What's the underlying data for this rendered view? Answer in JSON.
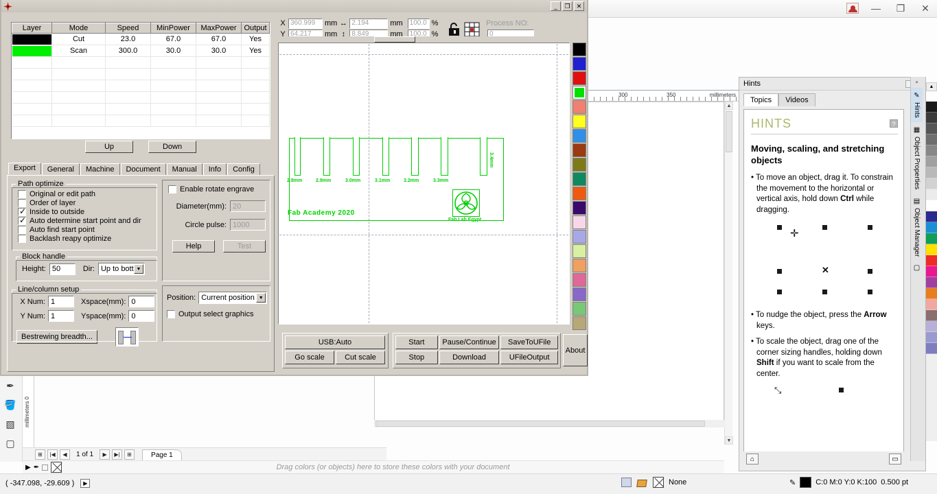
{
  "corel": {
    "window_controls": {
      "minimize": "—",
      "restore": "❐",
      "close": "✕"
    },
    "ruler": {
      "ticks": [
        "300",
        "350"
      ],
      "units": "millimeters",
      "vertical_label": "millimeters 0"
    },
    "page_nav": {
      "count": "1 of 1",
      "page_tab": "Page 1",
      "first": "|◀",
      "prev": "◀",
      "next": "▶",
      "last": "▶|",
      "add_before": "⊞",
      "add_after": "⊞"
    },
    "drag_hint": "Drag colors (or objects) here to store these colors with your document",
    "status": {
      "coords": "( -347.098, -29.609 )",
      "fill": "None",
      "outline": "C:0 M:0 Y:0 K:100",
      "outline_width": "0.500 pt"
    },
    "palette_colors": [
      "#1a1a1a",
      "#3b3b3b",
      "#555555",
      "#6e6e6e",
      "#878787",
      "#a0a0a0",
      "#b9b9b9",
      "#d2d2d2",
      "#ebebeb",
      "#ffffff",
      "#2b2b8f",
      "#1a8fd6",
      "#0f9d58",
      "#ffe000",
      "#ef2a2a",
      "#e8188f",
      "#a13fa0",
      "#e87d1e",
      "#f0a8a0",
      "#8a6f6f",
      "#b8b0d8",
      "#9a9ad0",
      "#7d7dc0"
    ]
  },
  "docker_tabs": [
    {
      "label": "Hints",
      "selected": true
    },
    {
      "label": "Object Properties",
      "selected": false
    },
    {
      "label": "Object Manager",
      "selected": false
    }
  ],
  "hints": {
    "title": "Hints",
    "tabs": [
      {
        "label": "Topics",
        "active": true
      },
      {
        "label": "Videos",
        "active": false
      }
    ],
    "heading": "HINTS",
    "help_badge": "?",
    "subheading": "Moving, scaling, and stretching objects",
    "bullets": [
      {
        "pre": "• To move an object, drag it. To constrain the movement to the horizontal or vertical axis, hold down ",
        "bold": "Ctrl",
        "post": " while dragging."
      },
      {
        "pre": "• To nudge the object, press the ",
        "bold": "Arrow",
        "post": " keys."
      },
      {
        "pre": "• To scale the object, drag one of the corner sizing handles, holding down ",
        "bold": "Shift",
        "post": " if you want to scale from the center."
      }
    ],
    "move_cursor": "✛",
    "center_marker": "✕",
    "scale_cursor": "⤡"
  },
  "laser": {
    "title": "",
    "window_controls": {
      "minimize": "_",
      "restore": "❐",
      "close": "✕"
    },
    "layer_table": {
      "headers": [
        "Layer",
        "Mode",
        "Speed",
        "MinPower",
        "MaxPower",
        "Output"
      ],
      "rows": [
        {
          "color": "#000000",
          "mode": "Cut",
          "speed": "23.0",
          "min_power": "67.0",
          "max_power": "67.0",
          "output": "Yes"
        },
        {
          "color": "#00ee00",
          "mode": "Scan",
          "speed": "300.0",
          "min_power": "30.0",
          "max_power": "30.0",
          "output": "Yes"
        }
      ]
    },
    "order_buttons": {
      "up": "Up",
      "down": "Down"
    },
    "tabs": [
      {
        "label": "Export",
        "active": true
      },
      {
        "label": "General",
        "active": false
      },
      {
        "label": "Machine",
        "active": false
      },
      {
        "label": "Document",
        "active": false
      },
      {
        "label": "Manual",
        "active": false
      },
      {
        "label": "Info",
        "active": false
      },
      {
        "label": "Config",
        "active": false
      }
    ],
    "path_optimize": {
      "legend": "Path optimize",
      "items": [
        {
          "label": "Original or edit path",
          "checked": false
        },
        {
          "label": "Order of layer",
          "checked": false
        },
        {
          "label": "Inside to outside",
          "checked": true
        },
        {
          "label": "Auto determine start point and dir",
          "checked": true
        },
        {
          "label": "Auto find start point",
          "checked": false
        },
        {
          "label": "Backlash reapy optimize",
          "checked": false
        }
      ]
    },
    "block_handle": {
      "legend": "Block handle",
      "height_label": "Height:",
      "height_value": "50",
      "dir_label": "Dir:",
      "dir_value": "Up to bott"
    },
    "rotate_engrave": {
      "enable_label": "Enable rotate engrave",
      "enabled": false,
      "diameter_label": "Diameter(mm):",
      "diameter_value": "20",
      "circle_pulse_label": "Circle pulse:",
      "circle_pulse_value": "1000",
      "help_button": "Help",
      "test_button": "Test"
    },
    "line_column": {
      "legend": "Line/column setup",
      "x_num_label": "X Num:",
      "x_num_value": "1",
      "xspace_label": "Xspace(mm):",
      "xspace_value": "0",
      "y_num_label": "Y Num:",
      "y_num_value": "1",
      "yspace_label": "Yspace(mm):",
      "yspace_value": "0",
      "bestrewing_button": "Bestrewing breadth..."
    },
    "position_group": {
      "position_label": "Position:",
      "position_value": "Current position",
      "output_select_label": "Output select graphics",
      "output_select_checked": false
    },
    "coord_toolbar": {
      "x_label": "X",
      "x_value": "360.999",
      "x_unit": "mm",
      "y_label": "Y",
      "y_value": "64.217",
      "y_unit": "mm",
      "w_value": "2.194",
      "w_unit": "mm",
      "h_value": "8.849",
      "h_unit": "mm",
      "wscale_value": "100.0",
      "wscale_unit": "%",
      "hscale_value": "100.0",
      "hscale_unit": "%",
      "process_no_label": "Process NO:",
      "process_no_value": "0",
      "lock_icon": "lock-icon",
      "anchor_icon": "anchor-grid-icon"
    },
    "device_buttons": {
      "usb": "USB:Auto",
      "go_scale": "Go scale",
      "cut_scale": "Cut scale"
    },
    "control_buttons": {
      "start": "Start",
      "pause": "Pause/Continue",
      "save_to_ufile": "SaveToUFile",
      "stop": "Stop",
      "download": "Download",
      "ufile_output": "UFileOutput"
    },
    "about_button": "About",
    "palette_colors": [
      "#000000",
      "#2020d0",
      "#e01010",
      "#00e000",
      "#f08070",
      "#ffff20",
      "#3090e8",
      "#9c3a10",
      "#7f7a18",
      "#0e8a60",
      "#f05a10",
      "#3a0a6a",
      "#f8d8e8",
      "#a8a8e8",
      "#d8f0a0",
      "#f0a060",
      "#e06898",
      "#8868c8",
      "#78c878",
      "#b8a878"
    ],
    "selected_palette_index": 3,
    "design": {
      "slot_labels": [
        "2.8mm",
        "2.9mm",
        "3.0mm",
        "3.1mm",
        "3.2mm",
        "3.3mm"
      ],
      "edge_label": "3.4mm",
      "title_text": "Fab Academy 2020",
      "logo_caption": "Fab Lab Egypt"
    }
  }
}
